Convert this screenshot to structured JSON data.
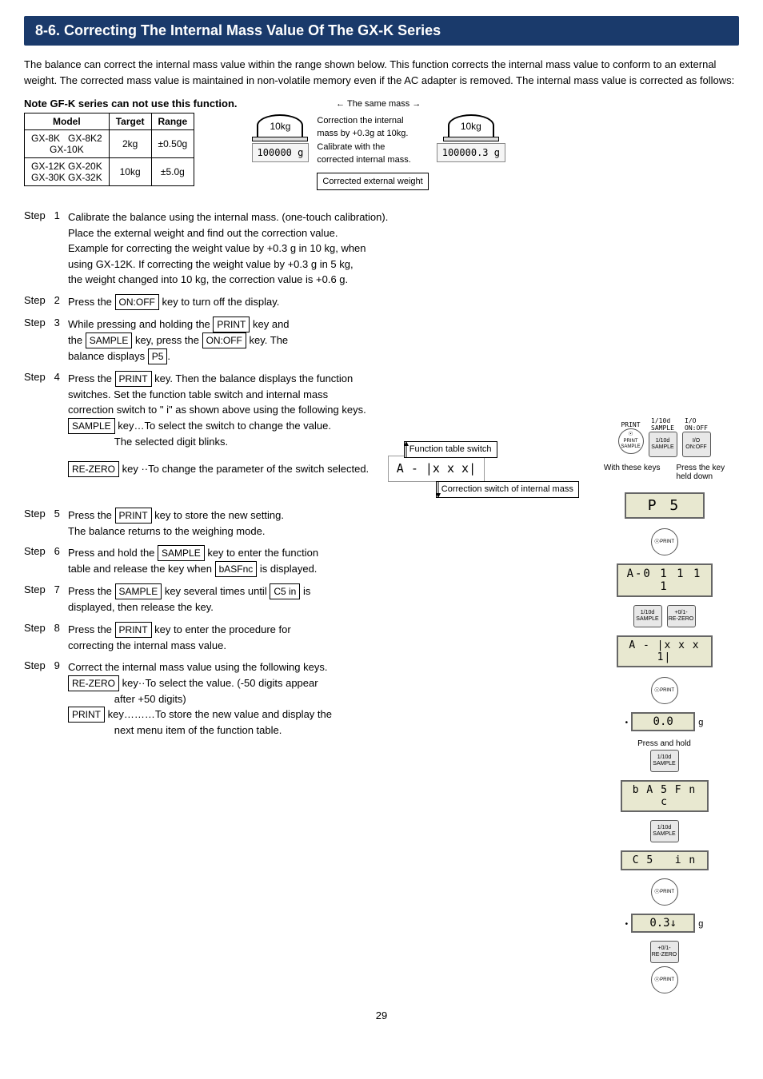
{
  "title": "8-6.  Correcting The Internal Mass Value Of The GX-K Series",
  "intro": "The balance can correct the internal mass value within the range shown below. This function corrects the internal mass value to conform to an external weight. The corrected mass value is maintained in non-volatile memory even if the AC adapter is removed. The internal mass value is corrected as follows:",
  "note_label": "Note  GF-K series can not use this function.",
  "table": {
    "headers": [
      "Model",
      "Target",
      "Range"
    ],
    "rows": [
      [
        "GX-8K    GX-8K2\nGX-10K",
        "2kg",
        "±0.50g"
      ],
      [
        "GX-12K  GX-20K\nGX-30K  GX-32K",
        "10kg",
        "±5.0g"
      ]
    ]
  },
  "diagram": {
    "same_mass_label": "The same mass",
    "weight1": "10kg",
    "weight2": "10kg",
    "display1": "100000",
    "display1_unit": "g",
    "display2": "100000.3",
    "display2_unit": "g",
    "correction_text": "Correction the internal\nmass by +0.3g at 10kg.\nCalibrate with the\ncorrected internal mass.",
    "corrected_label": "Corrected external weight"
  },
  "steps": [
    {
      "num": "1",
      "text": "Calibrate the balance using the internal mass. (one-touch calibration).\nPlace the external weight and find out the correction value.\nExample for correcting the weight value by +0.3 g in 10 kg, when\nusing GX-12K. If correcting the weight value by +0.3 g in 5 kg,\nthe weight changed into 10 kg, the correction value is +0.6 g."
    },
    {
      "num": "2",
      "text": "Press the  ON:OFF  key to turn off the display."
    },
    {
      "num": "3",
      "text": "While pressing and holding the  PRINT  key and\nthe  SAMPLE  key, press the  ON:OFF  key. The\nbalance displays  P5 ."
    },
    {
      "num": "4",
      "text": "Press the  PRINT  key. Then the balance displays the function\nswitches. Set the function table switch and internal mass\ncorrection switch to \" i\" as shown above using the following keys.\n SAMPLE  key…To select the switch to change the value.\n         The selected digit blinks.\n RE-ZERO  key ··To change the parameter of the switch selected."
    },
    {
      "num": "5",
      "text": "Press the  PRINT  key to store the new setting.\nThe balance returns to the weighing mode."
    },
    {
      "num": "6",
      "text": "Press and hold the  SAMPLE  key to enter the function\ntable and release the key when  bASFnc  is displayed."
    },
    {
      "num": "7",
      "text": "Press the  SAMPLE  key several times until  C5  in  is\ndisplayed, then release the key."
    },
    {
      "num": "8",
      "text": "Press the  PRINT  key to enter the procedure for\ncorrecting the internal mass value."
    },
    {
      "num": "9",
      "text": "Correct the internal mass value using the following keys.\n RE-ZERO  key··To select the value. (-50 digits appear\n          after +50 digits)\n PRINT  key………To store the new value and display the\n          next menu item of the function table."
    }
  ],
  "switch_diagram": {
    "code": "A - |x x x|",
    "function_label": "Function table switch",
    "correction_label": "Correction switch of internal mass"
  },
  "right_panel": {
    "keys_label1": "With these keys",
    "keys_label2": "Press the key held down",
    "displays": [
      "P 5",
      "A-0 1 1 1 1",
      "A - | x x x 1 |",
      "0.0 g",
      "b A 5 F n c",
      "C 5    i n",
      "0.3↓ g"
    ]
  },
  "page_number": "29"
}
